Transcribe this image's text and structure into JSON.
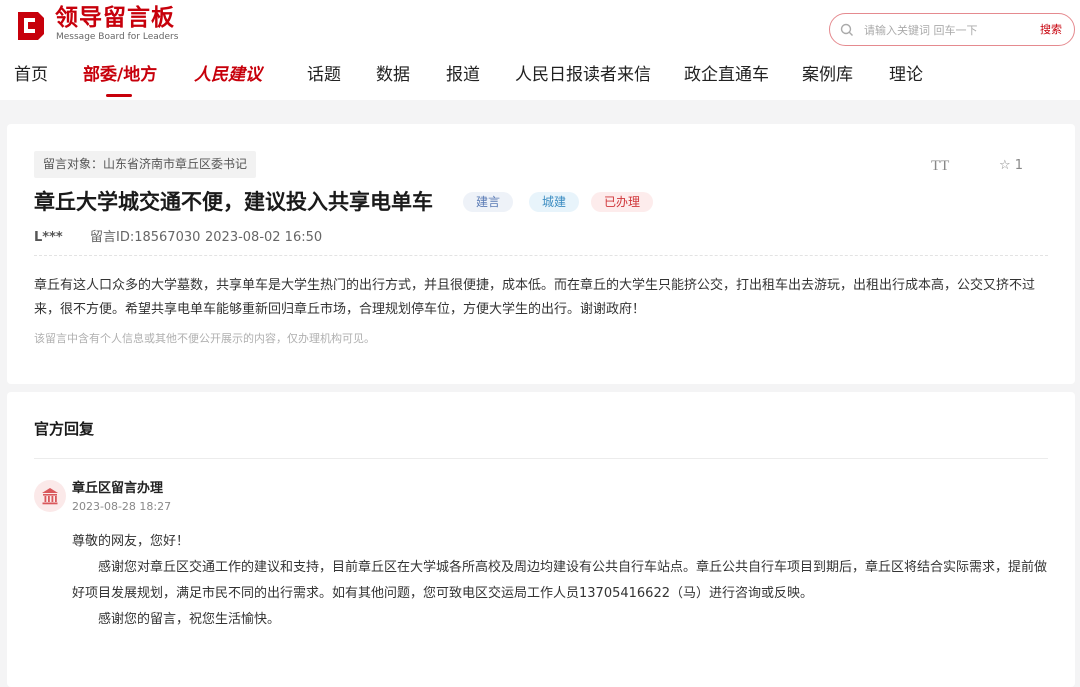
{
  "header": {
    "logo_cn": "领导留言板",
    "logo_en": "Message Board for Leaders",
    "search_placeholder": "请输入关键词 回车一下",
    "search_button": "搜索"
  },
  "nav": {
    "items": [
      "首页",
      "部委/地方",
      "人民建议",
      "话题",
      "数据",
      "报道",
      "人民日报读者来信",
      "政企直通车",
      "案例库",
      "理论"
    ],
    "active_index": 1
  },
  "message": {
    "target": "留言对象：山东省济南市章丘区委书记",
    "font_toggle": "TT",
    "favorite_count": "1",
    "title": "章丘大学城交通不便，建议投入共享电单车",
    "tags": [
      "建言",
      "城建",
      "已办理"
    ],
    "author": "L***",
    "id": "留言ID:18567030",
    "time": "2023-08-02 16:50",
    "content": "章丘有这人口众多的大学墓数，共享单车是大学生热门的出行方式，并且很便捷，成本低。而在章丘的大学生只能挤公交，打出租车出去游玩，出租出行成本高，公交又挤不过来，很不方便。希望共享电单车能够重新回归章丘市场，合理规划停车位，方便大学生的出行。谢谢政府！",
    "privacy_note": "该留言中含有个人信息或其他不便公开展示的内容，仅办理机构可见。"
  },
  "reply": {
    "heading": "官方回复",
    "org": "章丘区留言办理",
    "time": "2023-08-28 18:27",
    "greeting": "尊敬的网友，您好！",
    "body": "感谢您对章丘区交通工作的建议和支持，目前章丘区在大学城各所高校及周边均建设有公共自行车站点。章丘公共自行车项目到期后，章丘区将结合实际需求，提前做好项目发展规划，满足市民不同的出行需求。如有其他问题，您可致电区交运局工作人员13705416622（马）进行咨询或反映。",
    "closing": "感谢您的留言，祝您生活愉快。"
  },
  "colors": {
    "brand_red": "#c7000b",
    "background": "#f4f4f5"
  }
}
